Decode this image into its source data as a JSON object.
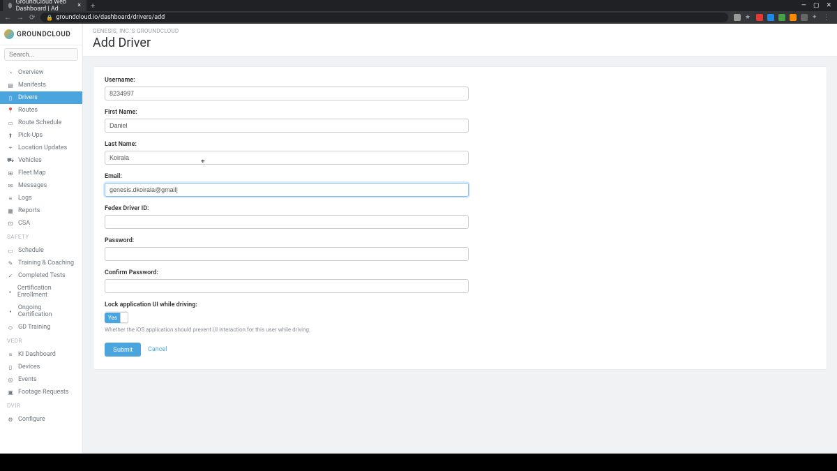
{
  "browser": {
    "tab_title": "GroundCloud Web Dashboard | Ad",
    "new_tab": "+",
    "url": "groundcloud.io/dashboard/drivers/add",
    "window": {
      "min": "—",
      "max": "▢",
      "close": "✕"
    }
  },
  "brand": {
    "name": "GROUNDCLOUD"
  },
  "search": {
    "placeholder": "Search..."
  },
  "nav": {
    "main": [
      {
        "icon": "◔",
        "label": "Overview"
      },
      {
        "icon": "▤",
        "label": "Manifests"
      },
      {
        "icon": "▯",
        "label": "Drivers",
        "active": true
      },
      {
        "icon": "📍",
        "label": "Routes"
      },
      {
        "icon": "▭",
        "label": "Route Schedule"
      },
      {
        "icon": "⬆",
        "label": "Pick-Ups"
      },
      {
        "icon": "⌖",
        "label": "Location Updates"
      },
      {
        "icon": "⛟",
        "label": "Vehicles"
      },
      {
        "icon": "⊞",
        "label": "Fleet Map"
      },
      {
        "icon": "✉",
        "label": "Messages"
      },
      {
        "icon": "≡",
        "label": "Logs"
      },
      {
        "icon": "▦",
        "label": "Reports"
      },
      {
        "icon": "⊡",
        "label": "CSA"
      }
    ],
    "group_safety": "SAFETY",
    "safety": [
      {
        "icon": "▭",
        "label": "Schedule"
      },
      {
        "icon": "✎",
        "label": "Training & Coaching"
      },
      {
        "icon": "✓",
        "label": "Completed Tests"
      },
      {
        "icon": "▪",
        "label": "Certification Enrollment"
      },
      {
        "icon": "▪",
        "label": "Ongoing Certification"
      },
      {
        "icon": "◇",
        "label": "GD Training"
      }
    ],
    "group_vedr": "VEDR",
    "vedr": [
      {
        "icon": "≡",
        "label": "KI Dashboard"
      },
      {
        "icon": "▯",
        "label": "Devices"
      },
      {
        "icon": "◎",
        "label": "Events"
      },
      {
        "icon": "▣",
        "label": "Footage Requests"
      }
    ],
    "group_dvir": "DVIR",
    "dvir": [
      {
        "icon": "⚙",
        "label": "Configure"
      }
    ]
  },
  "page": {
    "breadcrumb": "GENESIS, INC.'S GROUNDCLOUD",
    "title": "Add Driver"
  },
  "form": {
    "username": {
      "label": "Username:",
      "value": "8234997"
    },
    "first_name": {
      "label": "First Name:",
      "value": "Daniel"
    },
    "last_name": {
      "label": "Last Name:",
      "value": "Koirala"
    },
    "email": {
      "label": "Email:",
      "value": "genesis.dkoirala@gmail|"
    },
    "fedex_id": {
      "label": "Fedex Driver ID:",
      "value": ""
    },
    "password": {
      "label": "Password:",
      "value": ""
    },
    "confirm_password": {
      "label": "Confirm Password:",
      "value": ""
    },
    "lock_ui": {
      "label": "Lock application UI while driving:",
      "toggle": "Yes",
      "help": "Whether the iOS application should prevent UI interaction for this user while driving."
    },
    "submit": "Submit",
    "cancel": "Cancel"
  }
}
